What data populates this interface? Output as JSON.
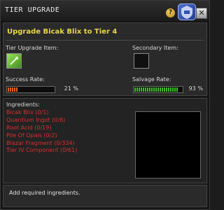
{
  "window": {
    "title": "TIER UPGRADE",
    "help_label": "?",
    "close_label": "✕",
    "emblem_icon": "guild-emblem-icon"
  },
  "upgrade": {
    "heading": "Upgrade Bicak Blix to Tier 4",
    "tier_item_label": "Tier Upgrade Item:",
    "secondary_item_label": "Secondary Item:",
    "success_label": "Success Rate:",
    "success_value": "21 %",
    "success_fraction": 0.21,
    "salvage_label": "Salvage Rate:",
    "salvage_value": "93 %",
    "salvage_fraction": 0.93,
    "tier_item_icon": "green-crystal-icon",
    "colors": {
      "heading": "#e6d64a",
      "success_bar": "#e0651c",
      "salvage_bar": "#3fbf2a",
      "missing_ingredient": "#d82f2f"
    }
  },
  "ingredients": {
    "header": "Ingredients:",
    "items": [
      "Bicak Blix (0/1)",
      "Quantium Ingot (0/6)",
      "Root Acid (0/19)",
      "Pile Of Opals (0/2)",
      "Blazar Fragment (0/334)",
      "Tier IV Component (0/61)"
    ]
  },
  "status": {
    "message": "Add required ingredients."
  }
}
